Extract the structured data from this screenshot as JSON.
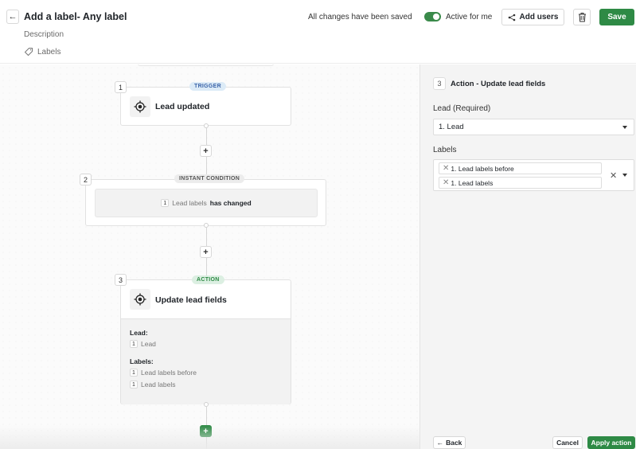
{
  "header": {
    "title": "Add a label- Any label",
    "description": "Description",
    "labels_link": "Labels",
    "save_status": "All changes have been saved",
    "active_toggle": {
      "label": "Active for me",
      "on": true
    },
    "add_users_label": "Add users",
    "save_label": "Save"
  },
  "workflow": {
    "steps": [
      {
        "number": "1",
        "type": "TRIGGER",
        "title": "Lead updated",
        "icon": "target-icon"
      },
      {
        "number": "2",
        "type": "INSTANT CONDITION",
        "condition": {
          "ref": "1",
          "field": "Lead labels",
          "operator": "has changed"
        }
      },
      {
        "number": "3",
        "type": "ACTION",
        "title": "Update lead fields",
        "icon": "target-icon",
        "details": {
          "lead_label": "Lead:",
          "lead_items": [
            {
              "ref": "1",
              "text": "Lead"
            }
          ],
          "labels_label": "Labels:",
          "labels_items": [
            {
              "ref": "1",
              "text": "Lead labels before"
            },
            {
              "ref": "1",
              "text": "Lead labels"
            }
          ]
        }
      }
    ],
    "add_step_symbol": "+"
  },
  "panel": {
    "step_number": "3",
    "title": "Action - Update lead fields",
    "lead_field": {
      "label": "Lead (Required)",
      "value": "1. Lead"
    },
    "labels_field": {
      "label": "Labels",
      "chips": [
        "1. Lead labels before",
        "1. Lead labels"
      ]
    },
    "footer": {
      "back_label": "Back",
      "cancel_label": "Cancel",
      "apply_label": "Apply action"
    }
  },
  "colors": {
    "accent_green": "#2e8a45",
    "trigger_blue": "#3a63a8"
  }
}
